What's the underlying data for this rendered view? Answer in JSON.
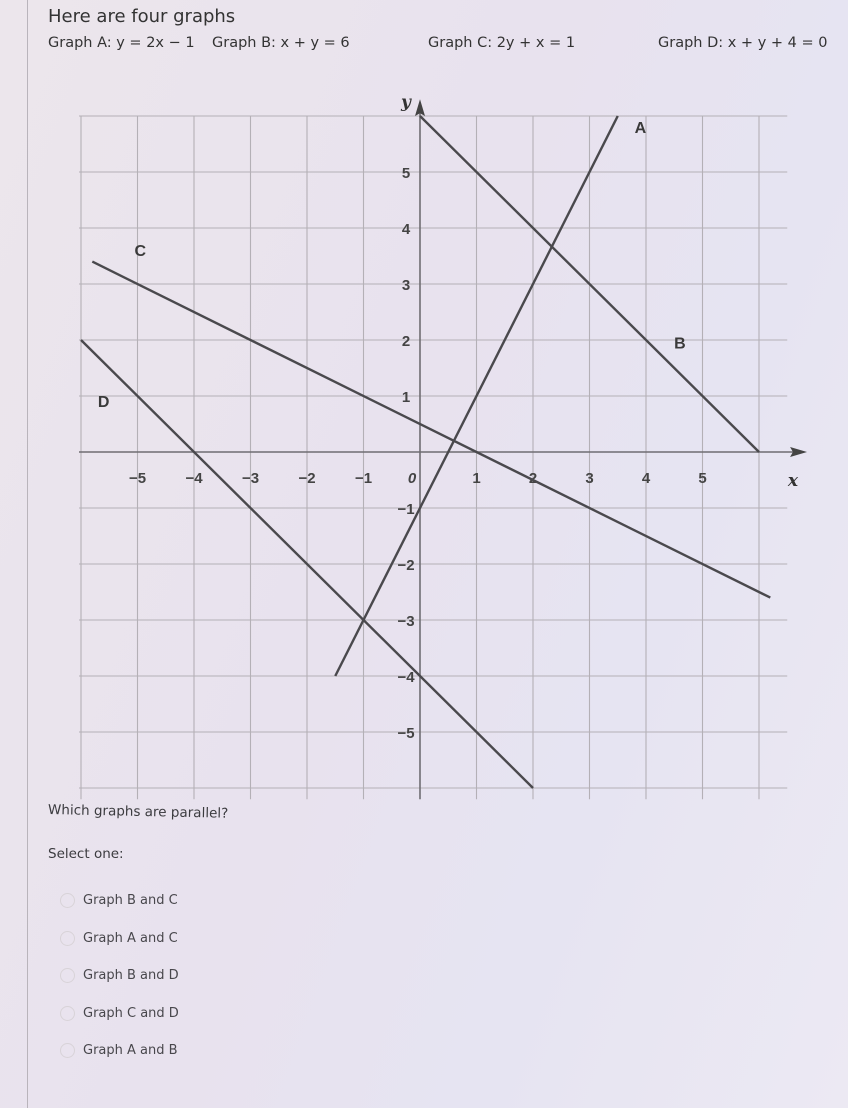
{
  "header": {
    "title": "Here are four graphs",
    "equations": [
      {
        "id": "A",
        "text": "Graph A: y = 2x − 1"
      },
      {
        "id": "B",
        "text": "Graph B: x + y = 6"
      },
      {
        "id": "C",
        "text": "Graph C: 2y + x = 1"
      },
      {
        "id": "D",
        "text": "Graph D: x + y + 4 = 0"
      }
    ]
  },
  "chart_data": {
    "type": "line",
    "title": "",
    "xlabel": "x",
    "ylabel": "y",
    "xlim": [
      -6,
      6.5
    ],
    "ylim": [
      -6.2,
      6
    ],
    "grid": true,
    "x_ticks": [
      "−5",
      "−4",
      "−3",
      "−2",
      "−1",
      "0",
      "1",
      "2",
      "3",
      "4",
      "5"
    ],
    "x_tick_values": [
      -5,
      -4,
      -3,
      -2,
      -1,
      0,
      1,
      2,
      3,
      4,
      5
    ],
    "y_ticks": [
      "5",
      "4",
      "3",
      "2",
      "1",
      "−1",
      "−2",
      "−3",
      "−4",
      "−5"
    ],
    "y_tick_values": [
      5,
      4,
      3,
      2,
      1,
      -1,
      -2,
      -3,
      -4,
      -5
    ],
    "series": [
      {
        "name": "A",
        "equation": "y = 2x - 1",
        "points": [
          [
            -1.5,
            -4.0
          ],
          [
            3.5,
            6.0
          ]
        ],
        "label_at": [
          3.9,
          5.7
        ]
      },
      {
        "name": "B",
        "equation": "x + y = 6",
        "points": [
          [
            0,
            6
          ],
          [
            6,
            0
          ]
        ],
        "label_at": [
          4.6,
          1.85
        ]
      },
      {
        "name": "C",
        "equation": "2y + x = 1",
        "points": [
          [
            -5.8,
            3.4
          ],
          [
            6.2,
            -2.6
          ]
        ],
        "label_at": [
          -4.95,
          3.5
        ]
      },
      {
        "name": "D",
        "equation": "x + y + 4 = 0",
        "points": [
          [
            -6,
            2
          ],
          [
            2,
            -6
          ]
        ],
        "label_at": [
          -5.6,
          0.8
        ]
      }
    ]
  },
  "question": {
    "prompt": "Which graphs are parallel?",
    "select_label": "Select one:",
    "options": [
      "Graph B and C",
      "Graph A and C",
      "Graph B and D",
      "Graph C and D",
      "Graph A and B"
    ]
  }
}
